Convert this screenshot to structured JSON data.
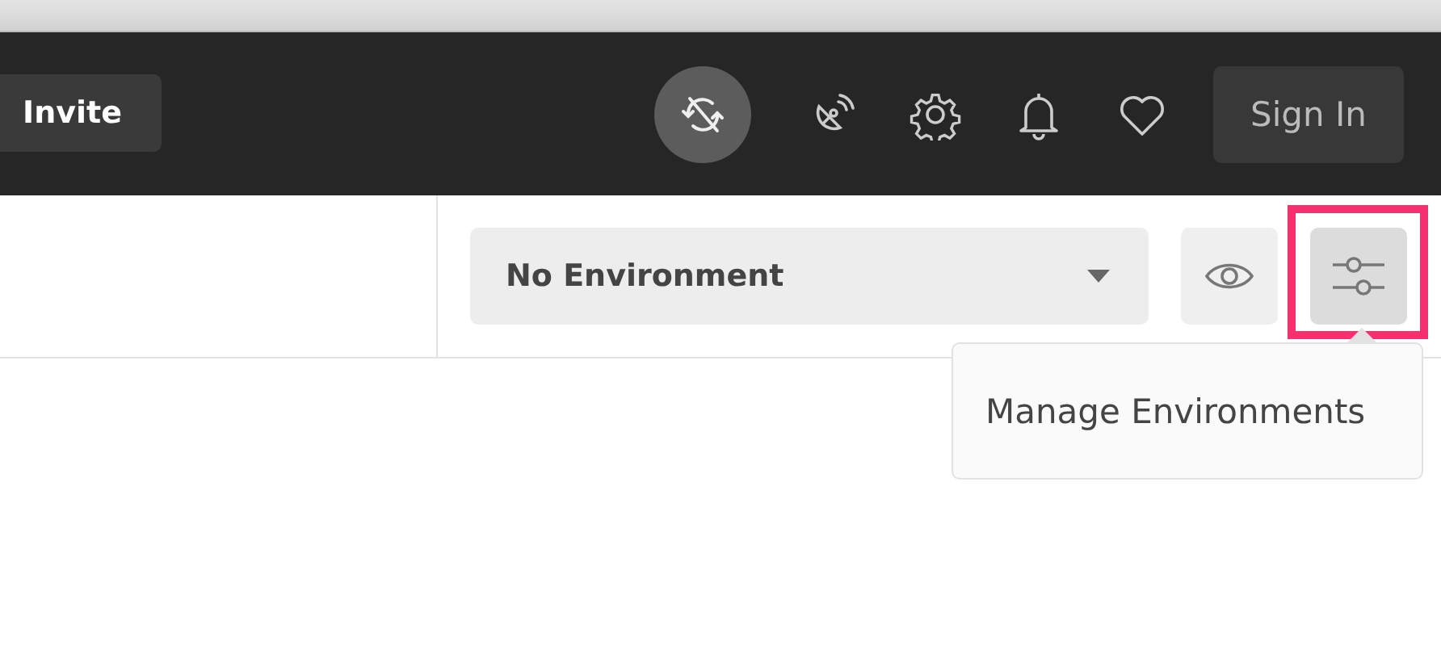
{
  "header": {
    "invite_button": "Invite",
    "sync_active": true,
    "sign_in_button": "Sign In"
  },
  "toolbar": {
    "environment": "No Environment",
    "settings_highlighted": true
  },
  "menu": {
    "items": [
      "Manage Environments"
    ]
  }
}
